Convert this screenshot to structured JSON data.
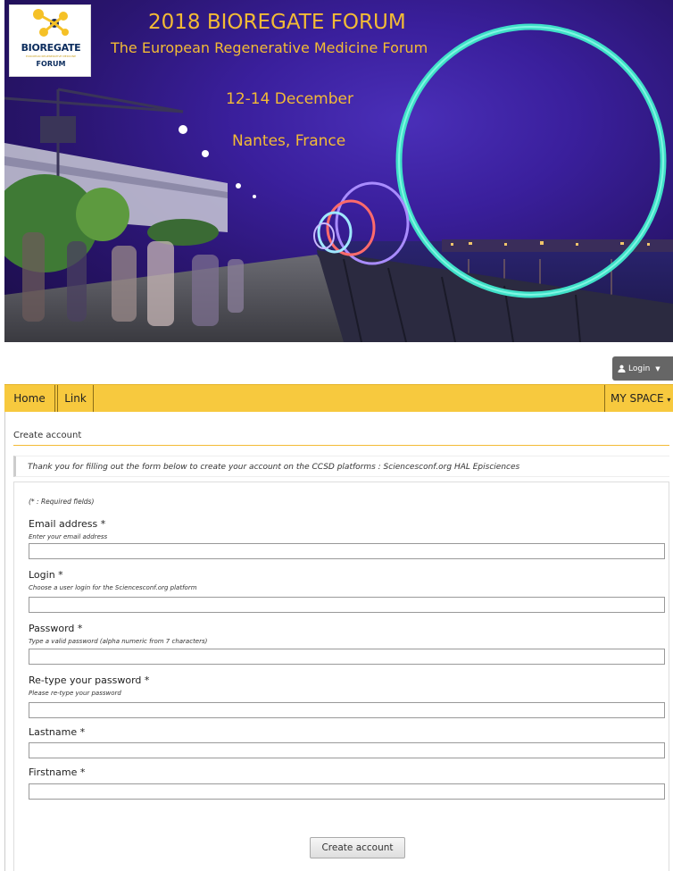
{
  "banner": {
    "title": "2018 BIOREGATE FORUM",
    "subtitle": "The European Regenerative Medicine Forum",
    "dates": "12-14 December",
    "location": "Nantes, France"
  },
  "logo": {
    "name": "BIOREGATE",
    "tagline": "EUROPEAN REGENERATIVE MEDICINE",
    "forum": "FORUM"
  },
  "header": {
    "login_label": "Login"
  },
  "nav": {
    "home": "Home",
    "link": "Link",
    "my_space": "MY SPACE"
  },
  "page": {
    "section_title": "Create account",
    "notice": "Thank you for filling out the form below to create your account on the CCSD platforms : Sciencesconf.org HAL Episciences",
    "required_note": "(* : Required fields)"
  },
  "form": {
    "email": {
      "label": "Email address *",
      "help": "Enter your email address",
      "value": ""
    },
    "login": {
      "label": "Login *",
      "help": "Choose a user login for the Sciencesconf.org platform",
      "value": ""
    },
    "password": {
      "label": "Password *",
      "help": "Type a valid password (alpha numeric from 7 characters)",
      "value": ""
    },
    "retype": {
      "label": "Re-type your password *",
      "help": "Please re-type your password",
      "value": ""
    },
    "lastname": {
      "label": "Lastname *",
      "value": ""
    },
    "firstname": {
      "label": "Firstname *",
      "value": ""
    },
    "submit_label": "Create account"
  },
  "colors": {
    "accent_yellow": "#f7c93e",
    "banner_text": "#f3bb35",
    "ring_teal": "#3fe0c8"
  }
}
